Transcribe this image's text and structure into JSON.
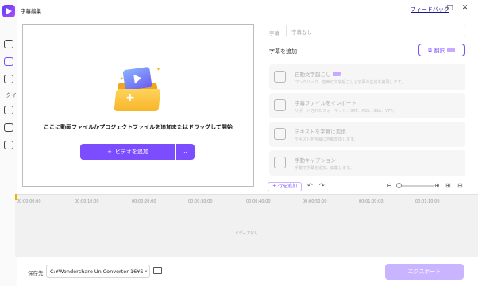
{
  "window": {
    "title": "字幕編集",
    "feedback_link": "フィードバック",
    "restore_glyph": "□",
    "close_glyph": "✕"
  },
  "rail": {
    "partial_label": "クイ",
    "icons": [
      "app-logo-icon",
      "home-icon",
      "toolbox-icon",
      "document-icon",
      "puzzle-icon",
      "edit-icon",
      "screen-record-icon"
    ]
  },
  "dropzone": {
    "instruction": "ここに動画ファイルかプロジェクトファイルを追加またはドラッグして開始",
    "add_video_label": "ビデオを追加",
    "add_icon": "+",
    "dropdown_glyph": "⌄"
  },
  "subtitle_panel": {
    "subtitle_label": "字幕",
    "subtitle_placeholder": "字幕なし",
    "add_subtitle_title": "字幕を追加",
    "translate_label": "翻訳",
    "options": [
      {
        "title": "自動文字起こし",
        "desc": "ワンクリック、音声の文字起こしと字幕の生成を実現します。",
        "icon": "auto-transcribe-icon"
      },
      {
        "title": "字幕ファイルをインポート",
        "desc": "サポートされたフォーマット：SRT、ASS、SSA、VTT。",
        "icon": "import-subtitle-icon"
      },
      {
        "title": "テキストを字幕に変換",
        "desc": "テキストを字幕に自動変換します。",
        "icon": "text-to-subtitle-icon"
      },
      {
        "title": "手動キャプション",
        "desc": "手動で字幕を追加、編集します。",
        "icon": "manual-caption-icon"
      }
    ],
    "add_row_label": "+ 行を追加",
    "undo_glyph": "↶",
    "redo_glyph": "↷",
    "zoom_out_glyph": "⊖",
    "zoom_in_glyph": "⊕"
  },
  "timeline": {
    "ruler": [
      "00:00:00:00",
      "00:00:10:00",
      "00:00:20:00",
      "00:00:30:00",
      "00:00:40:00",
      "00:00:50:00",
      "00:01:00:00",
      "00:01:10:00"
    ],
    "empty_text": "メディアなし"
  },
  "footer": {
    "save_label": "保存先",
    "save_path": "C:¥Wondershare UniConverter 16¥S",
    "export_label": "エクスポート"
  },
  "colors": {
    "accent": "#7b4dff",
    "export_disabled": "#c9b4ff",
    "folder": "#f7b52b",
    "playhead": "#f3b400"
  }
}
